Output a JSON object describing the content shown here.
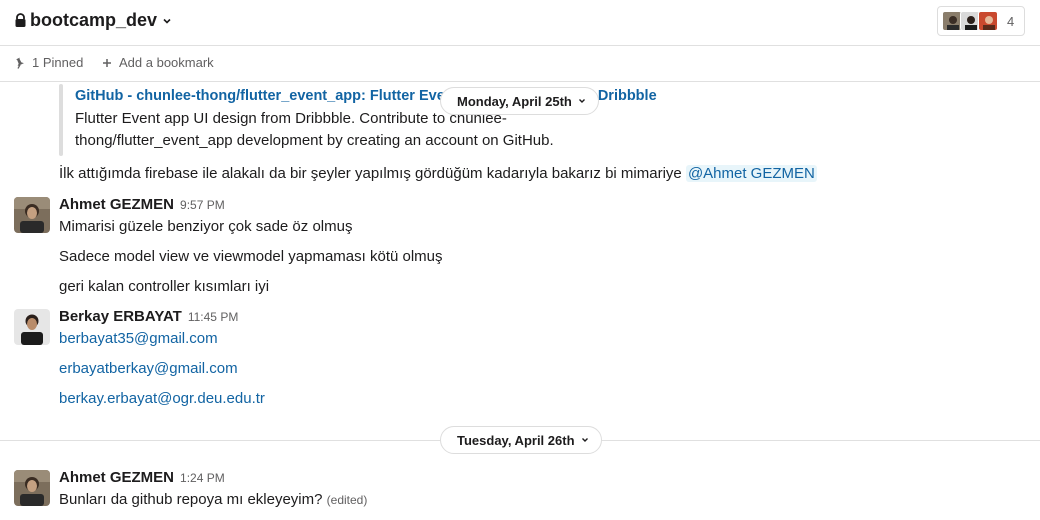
{
  "channel": {
    "name": "bootcamp_dev",
    "member_count": "4"
  },
  "bookmarks": {
    "pinned": "1 Pinned",
    "add": "Add a bookmark"
  },
  "attachment": {
    "title": "GitHub - chunlee-thong/flutter_event_app: Flutter Event app UI design from Dribbble",
    "description": "Flutter Event app UI design from Dribbble. Contribute to chunlee-thong/flutter_event_app development by creating an account on GitHub."
  },
  "messages_prev": {
    "text": "İlk attığımda firebase ile alakalı da bir şeyler yapılmış gördüğüm kadarıyla bakarız bi mimariye",
    "mention": "@Ahmet GEZMEN"
  },
  "dates": {
    "first": "Monday, April 25th",
    "second": "Tuesday, April 26th"
  },
  "msg1": {
    "user": "Ahmet GEZMEN",
    "time": "9:57 PM",
    "lines": [
      "Mimarisi güzele benziyor çok sade öz olmuş",
      "Sadece model view ve viewmodel yapmaması kötü olmuş",
      "geri kalan controller kısımları iyi"
    ]
  },
  "msg2": {
    "user": "Berkay ERBAYAT",
    "time": "11:45 PM",
    "lines": [
      "berbayat35@gmail.com",
      "erbayatberkay@gmail.com",
      "berkay.erbayat@ogr.deu.edu.tr"
    ]
  },
  "msg3": {
    "user": "Ahmet GEZMEN",
    "time": "1:24 PM",
    "text": "Bunları da github repoya mı ekleyeyim?",
    "edited": "(edited)"
  },
  "colors": {
    "link": "#1264a3",
    "mention_bg": "#e8f5fa",
    "text": "#1d1c1d",
    "muted": "#616061",
    "border": "#dddddd"
  }
}
